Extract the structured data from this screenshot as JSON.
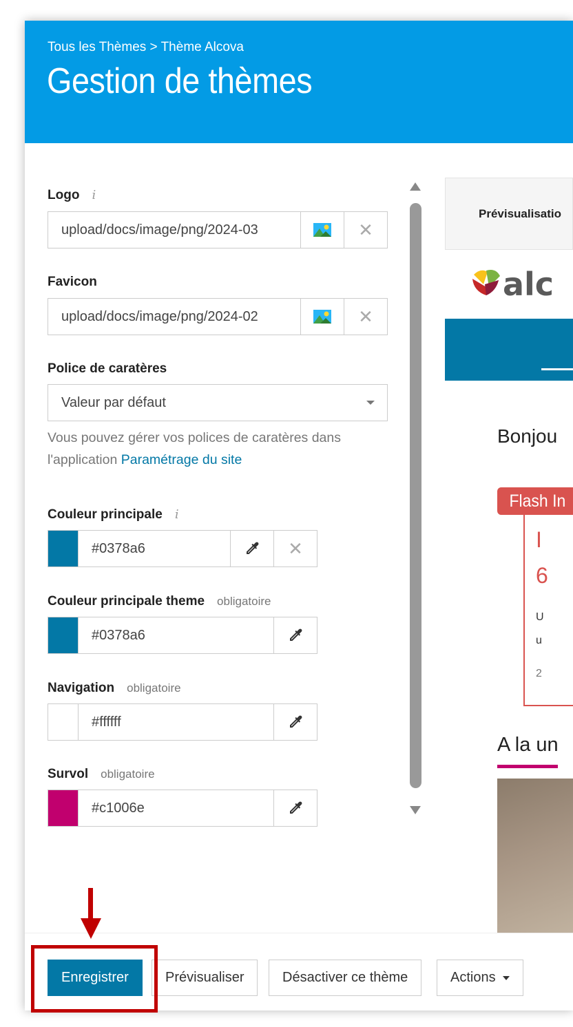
{
  "header": {
    "breadcrumb": "Tous les Thèmes > Thème Alcova",
    "title": "Gestion de thèmes"
  },
  "form": {
    "logo": {
      "label": "Logo",
      "value": "upload/docs/image/png/2024-03"
    },
    "favicon": {
      "label": "Favicon",
      "value": "upload/docs/image/png/2024-02"
    },
    "font": {
      "label": "Police de caratères",
      "selected": "Valeur par défaut",
      "help_prefix": "Vous pouvez gérer vos polices de caratères dans l'application",
      "help_link": "Paramétrage du site"
    },
    "main_color": {
      "label": "Couleur principale",
      "value": "#0378a6",
      "swatch": "#0378a6"
    },
    "theme_color": {
      "label": "Couleur principale theme",
      "hint": "obligatoire",
      "value": "#0378a6",
      "swatch": "#0378a6"
    },
    "navigation": {
      "label": "Navigation",
      "hint": "obligatoire",
      "value": "#ffffff",
      "swatch": "#ffffff"
    },
    "hover": {
      "label": "Survol",
      "hint": "obligatoire",
      "value": "#c1006e",
      "swatch": "#c1006e"
    }
  },
  "preview": {
    "title": "Prévisualisatio",
    "logo_text": "alc",
    "greeting": "Bonjou",
    "flash_label": "Flash In",
    "flash_big_1": "I",
    "flash_big_2": "6",
    "flash_small_1": "U",
    "flash_small_2": "u",
    "flash_small_3": "2",
    "une_title": "A la un"
  },
  "footer": {
    "save": "Enregistrer",
    "preview": "Prévisualiser",
    "deactivate": "Désactiver ce thème",
    "actions": "Actions"
  },
  "colors": {
    "header_bg": "#039be5",
    "primary": "#0378a6",
    "hover": "#c1006e",
    "flash": "#d9534f",
    "annotation": "#c00000"
  }
}
